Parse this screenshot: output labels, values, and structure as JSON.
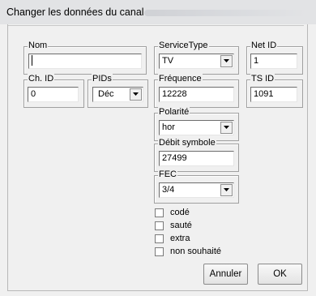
{
  "dialog": {
    "title": "Changer les données du canal"
  },
  "fields": {
    "nom": {
      "label": "Nom",
      "value": ""
    },
    "service_type": {
      "label": "ServiceType",
      "value": "TV"
    },
    "net_id": {
      "label": "Net ID",
      "value": "1"
    },
    "ch_id": {
      "label": "Ch. ID",
      "value": "0"
    },
    "pids": {
      "label": "PIDs",
      "value": "Déc"
    },
    "frequence": {
      "label": "Fréquence",
      "value": "12228"
    },
    "ts_id": {
      "label": "TS ID",
      "value": "1091"
    },
    "polarite": {
      "label": "Polarité",
      "value": "hor"
    },
    "debit_symbole": {
      "label": "Débit symbole",
      "value": "27499"
    },
    "fec": {
      "label": "FEC",
      "value": "3/4"
    }
  },
  "checkboxes": [
    {
      "label": "codé",
      "checked": false
    },
    {
      "label": "sauté",
      "checked": false
    },
    {
      "label": "extra",
      "checked": false
    },
    {
      "label": "non souhaité",
      "checked": false
    }
  ],
  "buttons": {
    "cancel": "Annuler",
    "ok": "OK"
  },
  "icons": {
    "dropdown": "chevron-down-icon",
    "caret": "text-caret"
  }
}
